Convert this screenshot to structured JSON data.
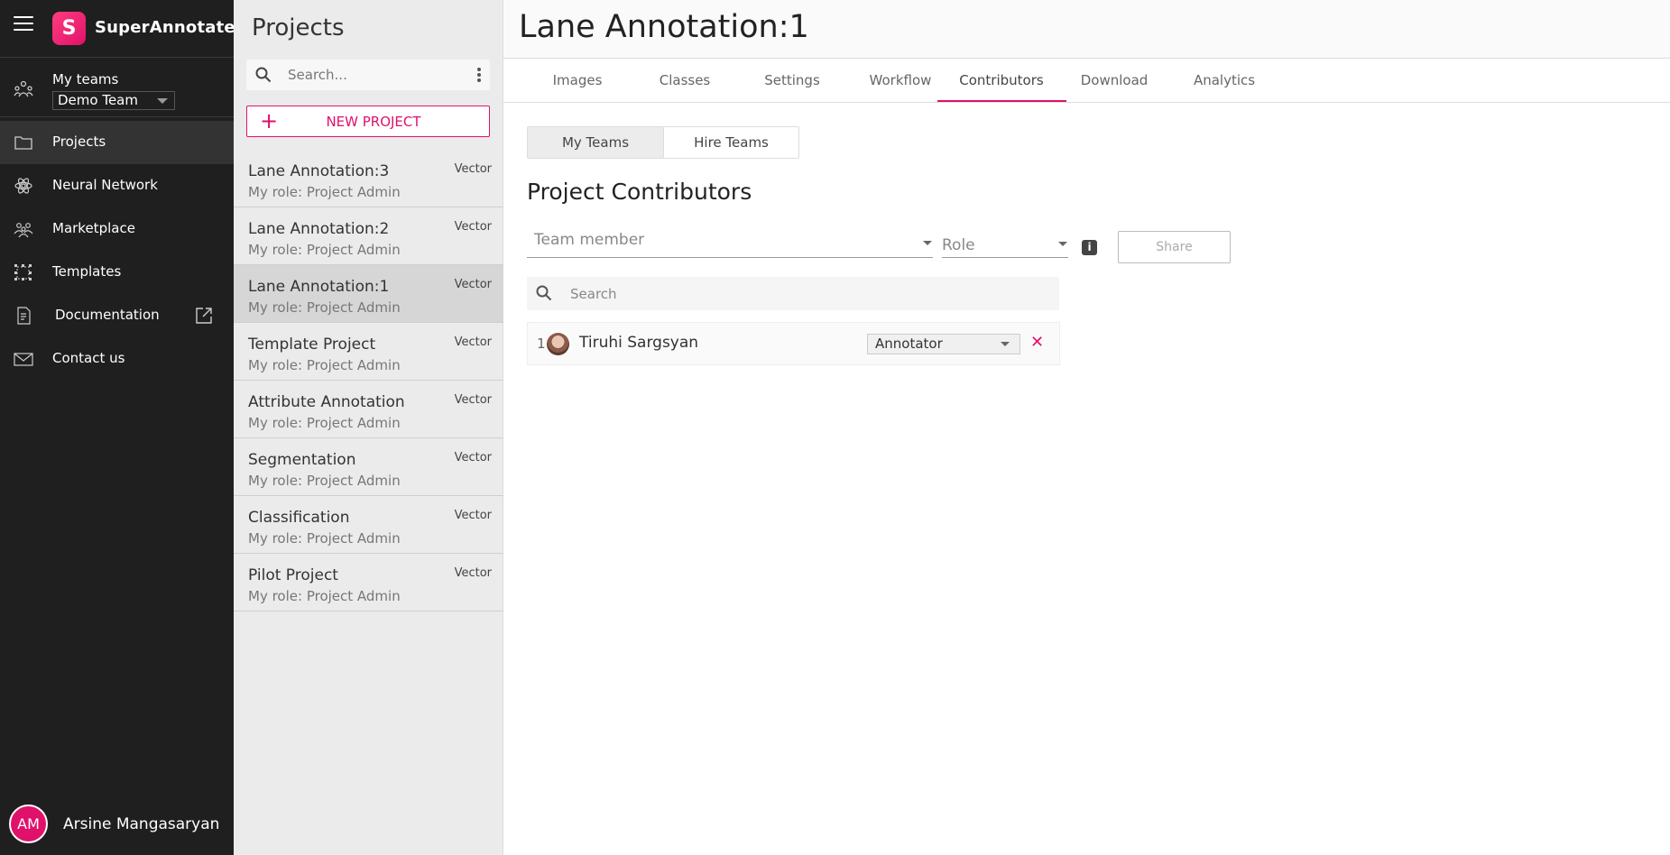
{
  "brand": {
    "name": "SuperAnnotate",
    "logo_letter": "S",
    "accent": "#e0116b"
  },
  "nav": {
    "teams_label": "My teams",
    "team_selected": "Demo Team",
    "items": [
      {
        "label": "Projects",
        "icon": "folder-icon"
      },
      {
        "label": "Neural Network",
        "icon": "neural-network-icon"
      },
      {
        "label": "Marketplace",
        "icon": "marketplace-icon"
      },
      {
        "label": "Templates",
        "icon": "templates-icon"
      },
      {
        "label": "Documentation",
        "icon": "documentation-icon"
      },
      {
        "label": "Contact us",
        "icon": "mail-icon"
      }
    ],
    "user_initials": "AM",
    "user_name": "Arsine Mangasaryan"
  },
  "projects_panel": {
    "title": "Projects",
    "search_placeholder": "Search...",
    "new_project_label": "NEW PROJECT",
    "items": [
      {
        "name": "Lane Annotation:3",
        "role": "My role: Project Admin",
        "type": "Vector"
      },
      {
        "name": "Lane Annotation:2",
        "role": "My role: Project Admin",
        "type": "Vector"
      },
      {
        "name": "Lane Annotation:1",
        "role": "My role: Project Admin",
        "type": "Vector"
      },
      {
        "name": "Template Project",
        "role": "My role: Project Admin",
        "type": "Vector"
      },
      {
        "name": "Attribute Annotation",
        "role": "My role: Project Admin",
        "type": "Vector"
      },
      {
        "name": "Segmentation",
        "role": "My role: Project Admin",
        "type": "Vector"
      },
      {
        "name": "Classification",
        "role": "My role: Project Admin",
        "type": "Vector"
      },
      {
        "name": "Pilot Project",
        "role": "My role: Project Admin",
        "type": "Vector"
      }
    ]
  },
  "main": {
    "title": "Lane Annotation:1",
    "tabs": [
      "Images",
      "Classes",
      "Settings",
      "Workflow",
      "Contributors",
      "Download",
      "Analytics"
    ],
    "active_tab": "Contributors",
    "segments": [
      "My Teams",
      "Hire Teams"
    ],
    "section_title": "Project Contributors",
    "team_member_placeholder": "Team member",
    "role_placeholder": "Role",
    "info_label": "i",
    "share_label": "Share",
    "search_placeholder": "Search",
    "contributors": [
      {
        "index": "1",
        "name": "Tiruhi Sargsyan",
        "role": "Annotator"
      }
    ]
  }
}
